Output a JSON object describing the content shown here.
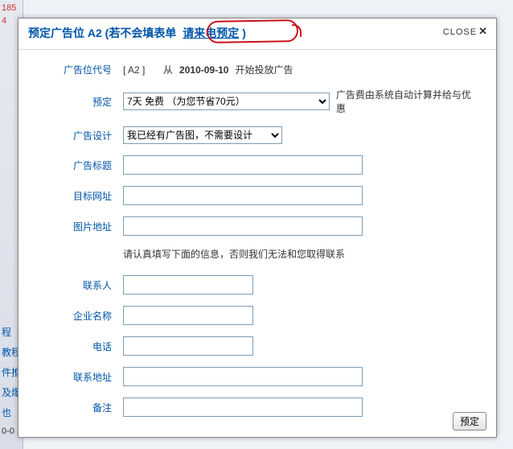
{
  "background": {
    "partial_top": "185",
    "partial_top2": "4",
    "side_links": [
      "程",
      "教程",
      "件推",
      "及爆",
      "也"
    ],
    "side_bottom": "0-0"
  },
  "dialog": {
    "title_prefix": "预定广告位 A2 (若不会填表单 ",
    "phone_link": "请来电预定",
    "title_suffix": ")",
    "close_label": "CLOSE",
    "rows": {
      "ad_code": {
        "label": "广告位代号",
        "code": "[ A2 ]",
        "date": "2010-09-10",
        "prefix": "从 ",
        "suffix": " 开始投放广告"
      },
      "reserve": {
        "label": "预定",
        "selected": "7天 免费 （为您节省70元）",
        "after": "广告费由系统自动计算并给与优惠"
      },
      "design": {
        "label": "广告设计",
        "selected": "我已经有广告图，不需要设计"
      },
      "ad_title": {
        "label": "广告标题"
      },
      "target": {
        "label": "目标网址"
      },
      "img_url": {
        "label": "图片地址"
      },
      "hint": "请认真填写下面的信息，否则我们无法和您取得联系",
      "contact": {
        "label": "联系人"
      },
      "company": {
        "label": "企业名称"
      },
      "phone": {
        "label": "电话"
      },
      "address": {
        "label": "联系地址"
      },
      "remark": {
        "label": "备注"
      }
    },
    "submit": "预定"
  }
}
